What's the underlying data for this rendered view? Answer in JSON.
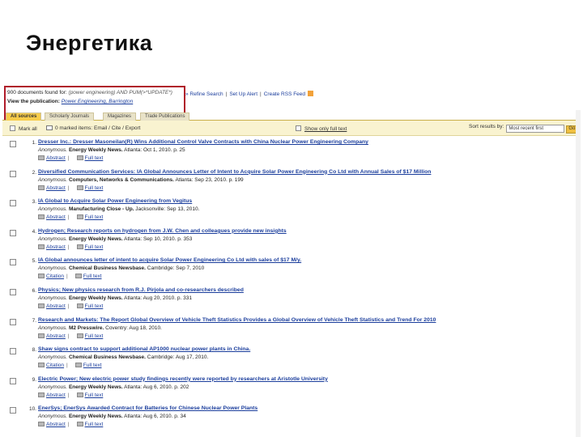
{
  "slide": {
    "title": "Энергетика"
  },
  "header": {
    "found_prefix": "900 documents found for:",
    "query": "(power engineering) AND PUM(>*UPDATE*)",
    "view_label": "View the publication:",
    "publication": "Power Engineering, Barrington",
    "refine": "» Refine Search",
    "alert": "Set Up Alert",
    "rss": "Create RSS Feed"
  },
  "tabs": [
    {
      "label": "All sources"
    },
    {
      "label": "Scholarly Journals"
    },
    {
      "label": "Magazines"
    },
    {
      "label": "Trade Publications"
    }
  ],
  "toolbar": {
    "mark_all": "Mark all",
    "marked": "0 marked items: Email / Cite / Export",
    "show_full": "Show only full text",
    "sort_label": "Sort results by:",
    "sort_value": "Most recent first",
    "go": "Go"
  },
  "results": [
    {
      "num": "1.",
      "title": "Dresser Inc.: Dresser Masoneilan(R) Wins Additional Control Valve Contracts with China Nuclear Power Engineering Company",
      "author": "Anonymous.",
      "source": "Energy Weekly News.",
      "details": "Atlanta: Oct 1, 2010. p. 25",
      "link1": "Abstract",
      "link2": "Full text"
    },
    {
      "num": "2.",
      "title": "Diversified Communication Services: IA Global Announces Letter of Intent to Acquire Solar Power Engineering Co Ltd with Annual Sales of $17 Million",
      "author": "Anonymous.",
      "source": "Computers, Networks & Communications.",
      "details": "Atlanta: Sep 23, 2010. p. 199",
      "link1": "Abstract",
      "link2": "Full text"
    },
    {
      "num": "3.",
      "title": "IA Global to Acquire Solar Power Engineering from Vegitus",
      "author": "Anonymous.",
      "source": "Manufacturing Close - Up.",
      "details": "Jacksonville: Sep 13, 2010.",
      "link1": "Abstract",
      "link2": "Full text"
    },
    {
      "num": "4.",
      "title": "Hydrogen; Research reports on hydrogen from J.W. Chen and colleagues provide new insights",
      "author": "Anonymous.",
      "source": "Energy Weekly News.",
      "details": "Atlanta: Sep 10, 2010. p. 353",
      "link1": "Abstract",
      "link2": "Full text"
    },
    {
      "num": "5.",
      "title": "IA Global announces letter of intent to acquire Solar Power Engineering Co Ltd with sales of $17 M/y.",
      "author": "Anonymous.",
      "source": "Chemical Business Newsbase.",
      "details": "Cambridge: Sep 7, 2010",
      "link1": "Citation",
      "link2": "Full text"
    },
    {
      "num": "6.",
      "title": "Physics; New physics research from R.J. Pirjola and co-researchers described",
      "author": "Anonymous.",
      "source": "Energy Weekly News.",
      "details": "Atlanta: Aug 20, 2010. p. 331",
      "link1": "Abstract",
      "link2": "Full text"
    },
    {
      "num": "7.",
      "title": "Research and Markets: The Report Global Overview of Vehicle Theft Statistics Provides a Global Overview of Vehicle Theft Statistics and Trend For 2010",
      "author": "Anonymous.",
      "source": "M2 Presswire.",
      "details": "Coventry: Aug 18, 2010.",
      "link1": "Abstract",
      "link2": "Full text"
    },
    {
      "num": "8.",
      "title": "Shaw signs contract to support additional AP1000 nuclear power plants in China.",
      "author": "Anonymous.",
      "source": "Chemical Business Newsbase.",
      "details": "Cambridge: Aug 17, 2010.",
      "link1": "Citation",
      "link2": "Full text"
    },
    {
      "num": "9.",
      "title": "Electric Power; New electric power study findings recently were reported by researchers at Aristotle University",
      "author": "Anonymous.",
      "source": "Energy Weekly News.",
      "details": "Atlanta: Aug 6, 2010. p. 202",
      "link1": "Abstract",
      "link2": "Full text"
    },
    {
      "num": "10.",
      "title": "EnerSys; EnerSys Awarded Contract for Batteries for Chinese Nuclear Power Plants",
      "author": "Anonymous.",
      "source": "Energy Weekly News.",
      "details": "Atlanta: Aug 6, 2010. p. 34",
      "link1": "Abstract",
      "link2": "Full text"
    }
  ]
}
